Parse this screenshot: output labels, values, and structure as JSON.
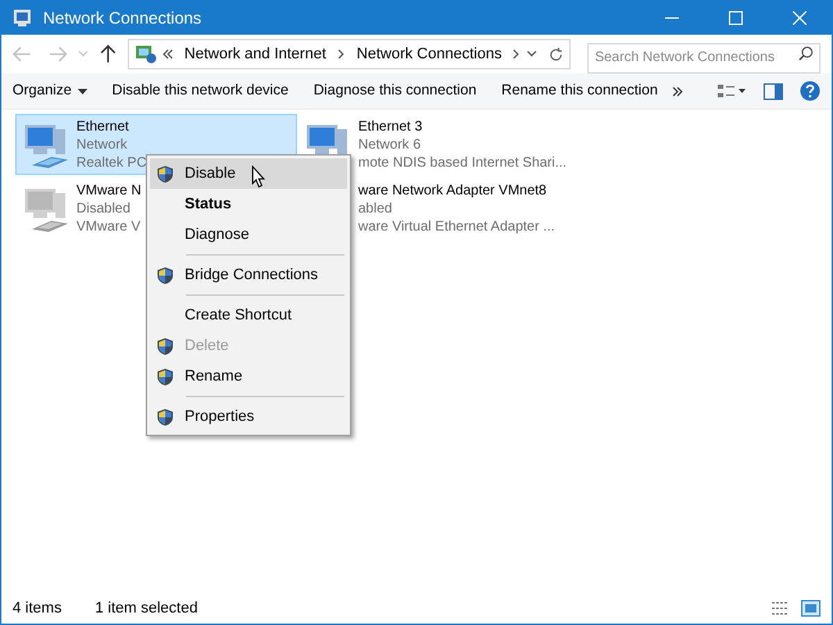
{
  "window": {
    "title": "Network Connections"
  },
  "address": {
    "crumbs": [
      "Network and Internet",
      "Network Connections"
    ]
  },
  "search": {
    "placeholder": "Search Network Connections"
  },
  "toolbar": {
    "buttons": [
      "Organize",
      "Disable this network device",
      "Diagnose this connection",
      "Rename this connection"
    ]
  },
  "connections": [
    {
      "selected": true,
      "kind": "adapter",
      "disabled": false,
      "lines": [
        "Ethernet",
        "Network",
        "Realtek PC"
      ]
    },
    {
      "selected": false,
      "kind": "adapter",
      "disabled": false,
      "lines": [
        "Ethernet 3",
        "Network 6",
        "mote NDIS based Internet Shari..."
      ]
    },
    {
      "selected": false,
      "kind": "adapter",
      "disabled": true,
      "lines": [
        "VMware N",
        "Disabled",
        "VMware V"
      ]
    },
    {
      "selected": false,
      "kind": "covered",
      "lines": [
        "ware Network Adapter VMnet8",
        "abled",
        "ware Virtual Ethernet Adapter ..."
      ]
    }
  ],
  "context_menu": [
    {
      "kind": "item",
      "label": "Disable",
      "shield": true,
      "bold": false,
      "disabled": false,
      "highlighted": true
    },
    {
      "kind": "item",
      "label": "Status",
      "shield": false,
      "bold": true,
      "disabled": false,
      "highlighted": false
    },
    {
      "kind": "item",
      "label": "Diagnose",
      "shield": false,
      "bold": false,
      "disabled": false,
      "highlighted": false
    },
    {
      "kind": "separator"
    },
    {
      "kind": "item",
      "label": "Bridge Connections",
      "shield": true,
      "bold": false,
      "disabled": false,
      "highlighted": false
    },
    {
      "kind": "separator"
    },
    {
      "kind": "item",
      "label": "Create Shortcut",
      "shield": false,
      "bold": false,
      "disabled": false,
      "highlighted": false
    },
    {
      "kind": "item",
      "label": "Delete",
      "shield": true,
      "bold": false,
      "disabled": true,
      "highlighted": false
    },
    {
      "kind": "item",
      "label": "Rename",
      "shield": true,
      "bold": false,
      "disabled": false,
      "highlighted": false
    },
    {
      "kind": "separator"
    },
    {
      "kind": "item",
      "label": "Properties",
      "shield": true,
      "bold": false,
      "disabled": false,
      "highlighted": false
    }
  ],
  "status_bar": {
    "count": "4 items",
    "selection": "1 item selected"
  }
}
